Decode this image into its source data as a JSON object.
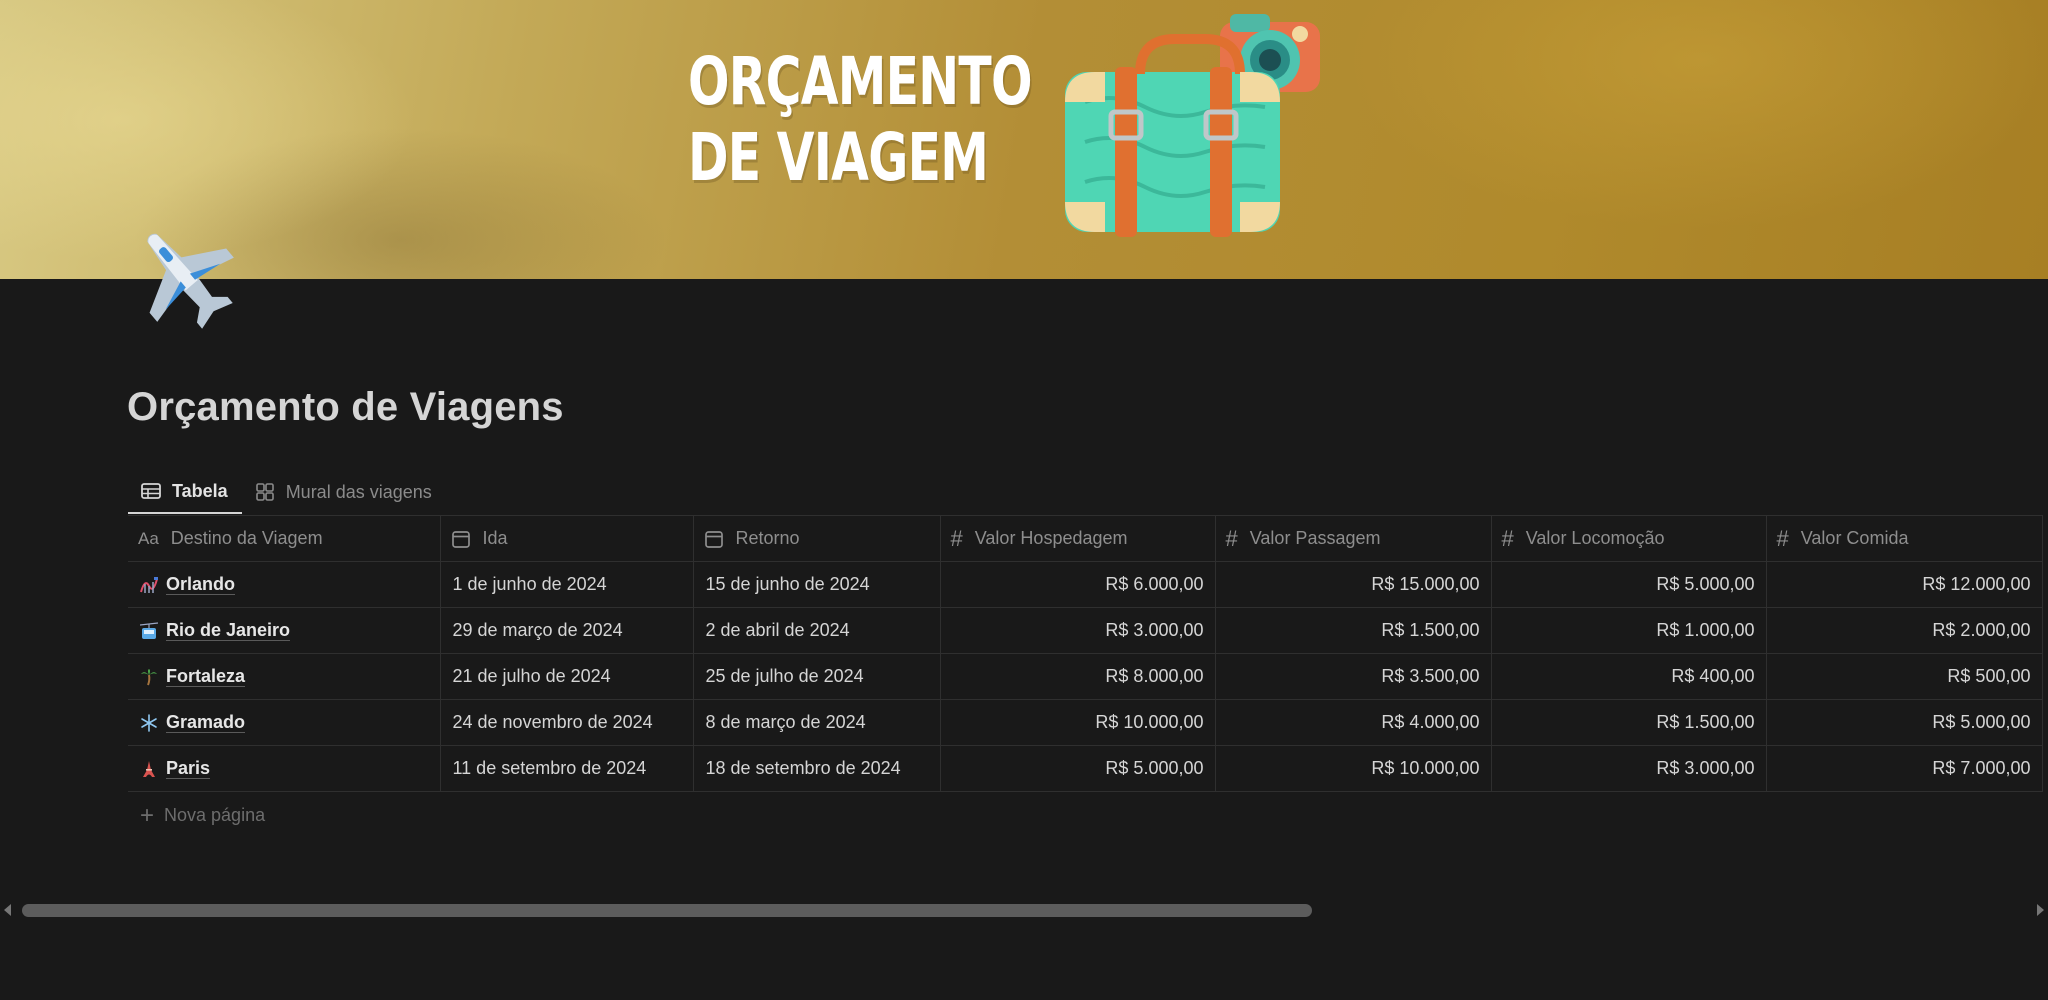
{
  "cover": {
    "title_line1": "ORÇAMENTO",
    "title_line2": "DE VIAGEM"
  },
  "page": {
    "icon": "airplane-icon",
    "title": "Orçamento de Viagens"
  },
  "tabs": [
    {
      "label": "Tabela",
      "icon": "table-icon",
      "active": true
    },
    {
      "label": "Mural das viagens",
      "icon": "gallery-icon",
      "active": false
    }
  ],
  "table": {
    "columns": [
      {
        "label": "Destino da Viagem",
        "icon": "text-property-icon",
        "prefix": "Aa"
      },
      {
        "label": "Ida",
        "icon": "calendar-icon"
      },
      {
        "label": "Retorno",
        "icon": "calendar-icon"
      },
      {
        "label": "Valor Hospedagem",
        "icon": "number-icon",
        "prefix": "#"
      },
      {
        "label": "Valor Passagem",
        "icon": "number-icon",
        "prefix": "#"
      },
      {
        "label": "Valor Locomoção",
        "icon": "number-icon",
        "prefix": "#"
      },
      {
        "label": "Valor Comida",
        "icon": "number-icon",
        "prefix": "#"
      }
    ],
    "rows": [
      {
        "icon": "roller-coaster-icon",
        "destino": "Orlando",
        "ida": "1 de junho de 2024",
        "retorno": "15 de junho de 2024",
        "hospedagem": "R$ 6.000,00",
        "passagem": "R$ 15.000,00",
        "locomocao": "R$ 5.000,00",
        "comida": "R$ 12.000,00"
      },
      {
        "icon": "cable-car-icon",
        "destino": "Rio de Janeiro",
        "ida": "29 de março de 2024",
        "retorno": "2 de abril de 2024",
        "hospedagem": "R$ 3.000,00",
        "passagem": "R$ 1.500,00",
        "locomocao": "R$ 1.000,00",
        "comida": "R$ 2.000,00"
      },
      {
        "icon": "palm-tree-icon",
        "destino": "Fortaleza",
        "ida": "21 de julho de 2024",
        "retorno": "25 de julho de 2024",
        "hospedagem": "R$ 8.000,00",
        "passagem": "R$ 3.500,00",
        "locomocao": "R$ 400,00",
        "comida": "R$ 500,00"
      },
      {
        "icon": "snowflake-icon",
        "destino": "Gramado",
        "ida": "24 de novembro de 2024",
        "retorno": "8 de março de 2024",
        "hospedagem": "R$ 10.000,00",
        "passagem": "R$ 4.000,00",
        "locomocao": "R$ 1.500,00",
        "comida": "R$ 5.000,00"
      },
      {
        "icon": "eiffel-tower-icon",
        "destino": "Paris",
        "ida": "11 de setembro de 2024",
        "retorno": "18 de setembro de 2024",
        "hospedagem": "R$ 5.000,00",
        "passagem": "R$ 10.000,00",
        "locomocao": "R$ 3.000,00",
        "comida": "R$ 7.000,00"
      }
    ],
    "new_page_label": "Nova página"
  },
  "colors": {
    "background": "#191919",
    "text": "#d5d5d5",
    "muted": "#8e8e8e",
    "border": "#2f2f2f",
    "cover_gold": "#b08a2c"
  }
}
